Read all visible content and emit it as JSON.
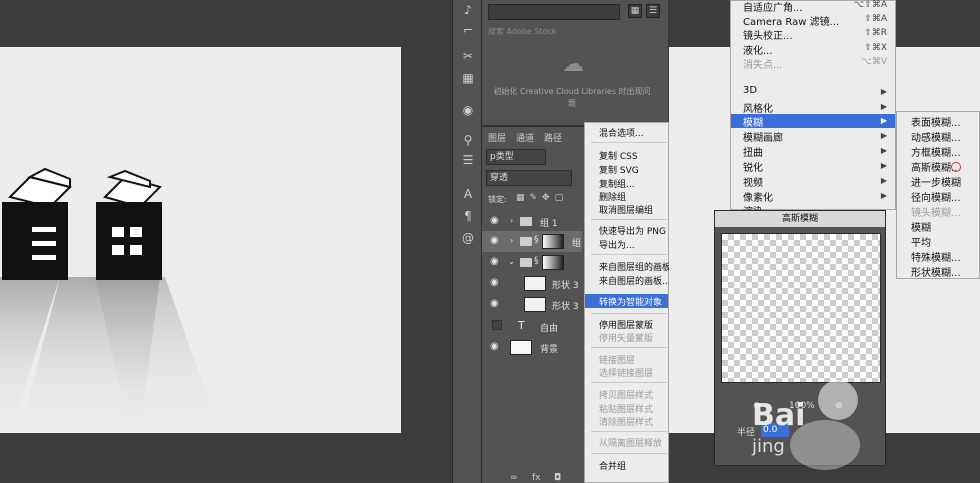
{
  "left_canvas": {
    "letters": [
      "自",
      "由"
    ]
  },
  "libraries": {
    "search_placeholder": "搜索 Adobe Stock",
    "message": "初始化 Creative Cloud Libraries 时出现问题"
  },
  "layers": {
    "tabs": [
      "图层",
      "通道",
      "路径"
    ],
    "filter_kind": "p类型",
    "blend_mode": "穿透",
    "lock_label": "锁定:",
    "rows": [
      {
        "name": "组 1",
        "kind": "group"
      },
      {
        "name": "组",
        "kind": "group-selected"
      },
      {
        "name": "",
        "kind": "group-open"
      },
      {
        "name": "形状 3",
        "kind": "shape"
      },
      {
        "name": "形状 3",
        "kind": "shape"
      },
      {
        "name": "自由",
        "kind": "text"
      },
      {
        "name": "背景",
        "kind": "bg"
      }
    ],
    "footer_icons": [
      "link-icon",
      "fx-icon",
      "mask-icon"
    ]
  },
  "context_menu": {
    "items": [
      {
        "label": "混合选项...",
        "disabled": false
      },
      {
        "label": "复制 CSS",
        "disabled": false
      },
      {
        "label": "复制 SVG",
        "disabled": false
      },
      {
        "label": "复制组...",
        "disabled": false
      },
      {
        "label": "删除组",
        "disabled": false
      },
      {
        "label": "取消图层编组",
        "disabled": false
      },
      {
        "label": "快速导出为 PNG",
        "disabled": false
      },
      {
        "label": "导出为...",
        "disabled": false
      },
      {
        "label": "来自图层组的画板...",
        "disabled": false
      },
      {
        "label": "来自图层的画板...",
        "disabled": false
      },
      {
        "label": "转换为智能对象",
        "disabled": false,
        "highlighted": true
      },
      {
        "label": "停用图层蒙版",
        "disabled": false
      },
      {
        "label": "停用矢量蒙版",
        "disabled": true
      },
      {
        "label": "链接图层",
        "disabled": true
      },
      {
        "label": "选择链接图层",
        "disabled": true
      },
      {
        "label": "拷贝图层样式",
        "disabled": true
      },
      {
        "label": "粘贴图层样式",
        "disabled": true
      },
      {
        "label": "清除图层样式",
        "disabled": true
      },
      {
        "label": "从隔离图层释放",
        "disabled": true
      },
      {
        "label": "合并组",
        "disabled": false
      }
    ]
  },
  "filter_menu": {
    "items": [
      {
        "label": "自适应广角...",
        "shortcut": "⌥⇧⌘A"
      },
      {
        "label": "Camera Raw 滤镜...",
        "shortcut": "⇧⌘A"
      },
      {
        "label": "镜头校正...",
        "shortcut": "⇧⌘R"
      },
      {
        "label": "液化...",
        "shortcut": "⇧⌘X"
      },
      {
        "label": "消失点...",
        "shortcut": "⌥⌘V",
        "disabled": true
      },
      {
        "label": "3D",
        "submenu": true
      },
      {
        "label": "风格化",
        "submenu": true
      },
      {
        "label": "模糊",
        "submenu": true,
        "highlighted": true
      },
      {
        "label": "模糊画廊",
        "submenu": true
      },
      {
        "label": "扭曲",
        "submenu": true
      },
      {
        "label": "锐化",
        "submenu": true
      },
      {
        "label": "视频",
        "submenu": true
      },
      {
        "label": "像素化",
        "submenu": true
      },
      {
        "label": "渲染",
        "submenu": true
      }
    ]
  },
  "blur_submenu": {
    "items": [
      {
        "label": "表面模糊...",
        "disabled": false
      },
      {
        "label": "动感模糊...",
        "disabled": false
      },
      {
        "label": "方框模糊...",
        "disabled": false
      },
      {
        "label": "高斯模糊...",
        "disabled": false
      },
      {
        "label": "进一步模糊",
        "disabled": false
      },
      {
        "label": "径向模糊...",
        "disabled": false
      },
      {
        "label": "镜头模糊...",
        "disabled": true
      },
      {
        "label": "模糊",
        "disabled": false
      },
      {
        "label": "平均",
        "disabled": false
      },
      {
        "label": "特殊模糊...",
        "disabled": false
      },
      {
        "label": "形状模糊...",
        "disabled": false
      }
    ]
  },
  "gaussian_dialog": {
    "title": "高斯模糊",
    "zoom": "100%",
    "radius_label": "半径",
    "radius_value": "0.0"
  },
  "watermark": {
    "brand": "Bai",
    "sub": "jing"
  },
  "colors": {
    "highlight": "#3a6fd8",
    "panel": "#535353",
    "menu": "#ececec"
  }
}
